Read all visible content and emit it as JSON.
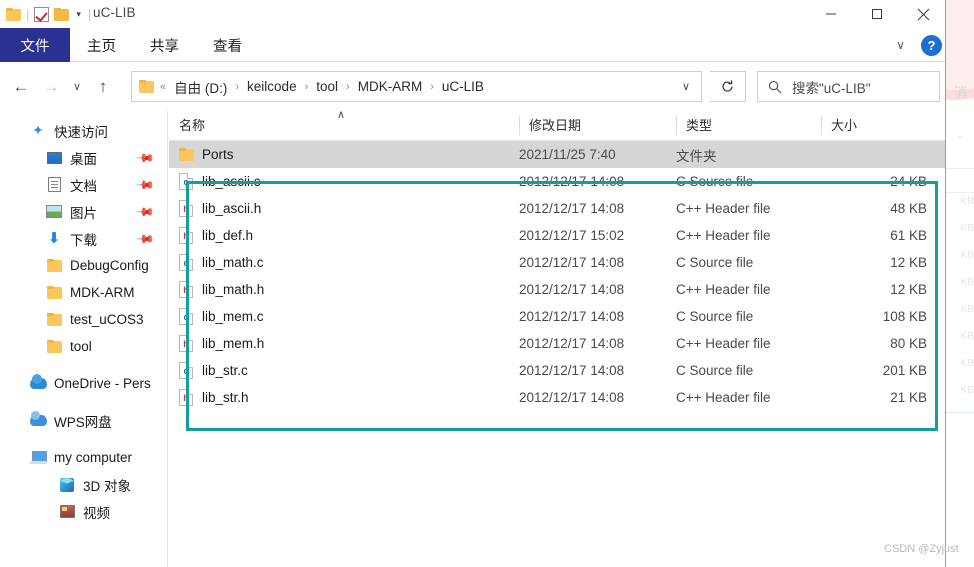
{
  "window": {
    "title": "uC-LIB",
    "quick_access_icons": [
      "folder-icon",
      "properties-checkbox-icon",
      "new-folder-icon",
      "customize-caret-icon"
    ],
    "controls": {
      "minimize": "–",
      "maximize": "□",
      "close": "✕"
    }
  },
  "ribbon": {
    "tabs": [
      {
        "label": "文件",
        "active": true
      },
      {
        "label": "主页",
        "active": false
      },
      {
        "label": "共享",
        "active": false
      },
      {
        "label": "查看",
        "active": false
      }
    ],
    "collapse_caret": "∨",
    "help_label": "?",
    "active_tab_color": "#2b3190"
  },
  "navigation": {
    "back": "←",
    "forward": "→",
    "recent_caret": "∨",
    "up": "↑"
  },
  "address_bar": {
    "root_chevrons": "«",
    "crumbs": [
      "自由 (D:)",
      "keilcode",
      "tool",
      "MDK-ARM",
      "uC-LIB"
    ],
    "separator": "›",
    "dropdown_caret": "∨",
    "refresh_icon": "↻"
  },
  "search": {
    "icon": "search-icon",
    "placeholder": "搜索\"uC-LIB\""
  },
  "sidebar": {
    "items": [
      {
        "label": "快速访问",
        "icon": "star-icon",
        "level": 0,
        "pinned": false
      },
      {
        "label": "桌面",
        "icon": "desktop-icon",
        "level": 1,
        "pinned": true
      },
      {
        "label": "文档",
        "icon": "documents-icon",
        "level": 1,
        "pinned": true
      },
      {
        "label": "图片",
        "icon": "pictures-icon",
        "level": 1,
        "pinned": true
      },
      {
        "label": "下载",
        "icon": "downloads-icon",
        "level": 1,
        "pinned": true
      },
      {
        "label": "DebugConfig",
        "icon": "folder-icon",
        "level": 1,
        "pinned": false
      },
      {
        "label": "MDK-ARM",
        "icon": "folder-icon",
        "level": 1,
        "pinned": false
      },
      {
        "label": "test_uCOS3",
        "icon": "folder-icon",
        "level": 1,
        "pinned": false
      },
      {
        "label": "tool",
        "icon": "folder-icon",
        "level": 1,
        "pinned": false
      },
      {
        "label": "OneDrive - Pers",
        "icon": "onedrive-icon",
        "level": 0,
        "pinned": false
      },
      {
        "label": "WPS网盘",
        "icon": "wps-cloud-icon",
        "level": 0,
        "pinned": false
      },
      {
        "label": "my computer",
        "icon": "this-pc-icon",
        "level": 0,
        "pinned": false
      },
      {
        "label": "3D 对象",
        "icon": "3d-objects-icon",
        "level": 1,
        "pinned": false
      },
      {
        "label": "视频",
        "icon": "videos-icon",
        "level": 1,
        "pinned": false
      }
    ]
  },
  "file_list": {
    "columns": [
      "名称",
      "修改日期",
      "类型",
      "大小"
    ],
    "sort_indicator": "∧",
    "rows": [
      {
        "name": "Ports",
        "date": "2021/11/25 7:40",
        "type": "文件夹",
        "size": "",
        "icon": "folder-icon",
        "selected": true
      },
      {
        "name": "lib_ascii.c",
        "date": "2012/12/17 14:08",
        "type": "C Source file",
        "size": "24 KB",
        "icon": "c-file-icon",
        "selected": false
      },
      {
        "name": "lib_ascii.h",
        "date": "2012/12/17 14:08",
        "type": "C++ Header file",
        "size": "48 KB",
        "icon": "h-file-icon",
        "selected": false
      },
      {
        "name": "lib_def.h",
        "date": "2012/12/17 15:02",
        "type": "C++ Header file",
        "size": "61 KB",
        "icon": "h-file-icon",
        "selected": false
      },
      {
        "name": "lib_math.c",
        "date": "2012/12/17 14:08",
        "type": "C Source file",
        "size": "12 KB",
        "icon": "c-file-icon",
        "selected": false
      },
      {
        "name": "lib_math.h",
        "date": "2012/12/17 14:08",
        "type": "C++ Header file",
        "size": "12 KB",
        "icon": "h-file-icon",
        "selected": false
      },
      {
        "name": "lib_mem.c",
        "date": "2012/12/17 14:08",
        "type": "C Source file",
        "size": "108 KB",
        "icon": "c-file-icon",
        "selected": false
      },
      {
        "name": "lib_mem.h",
        "date": "2012/12/17 14:08",
        "type": "C++ Header file",
        "size": "80 KB",
        "icon": "h-file-icon",
        "selected": false
      },
      {
        "name": "lib_str.c",
        "date": "2012/12/17 14:08",
        "type": "C Source file",
        "size": "201 KB",
        "icon": "c-file-icon",
        "selected": false
      },
      {
        "name": "lib_str.h",
        "date": "2012/12/17 14:08",
        "type": "C++ Header file",
        "size": "21 KB",
        "icon": "h-file-icon",
        "selected": false
      }
    ]
  },
  "annotation": {
    "highlight_color": "#119e9e",
    "label": "highlight-rectangle"
  },
  "watermark": {
    "text": "CSDN @Zyjust"
  },
  "background_edge": {
    "ghost_text": "消",
    "ghost_rows": [
      "KB",
      "KB",
      "KB",
      "KB",
      "KB",
      "KB",
      "KB",
      "KB"
    ]
  }
}
